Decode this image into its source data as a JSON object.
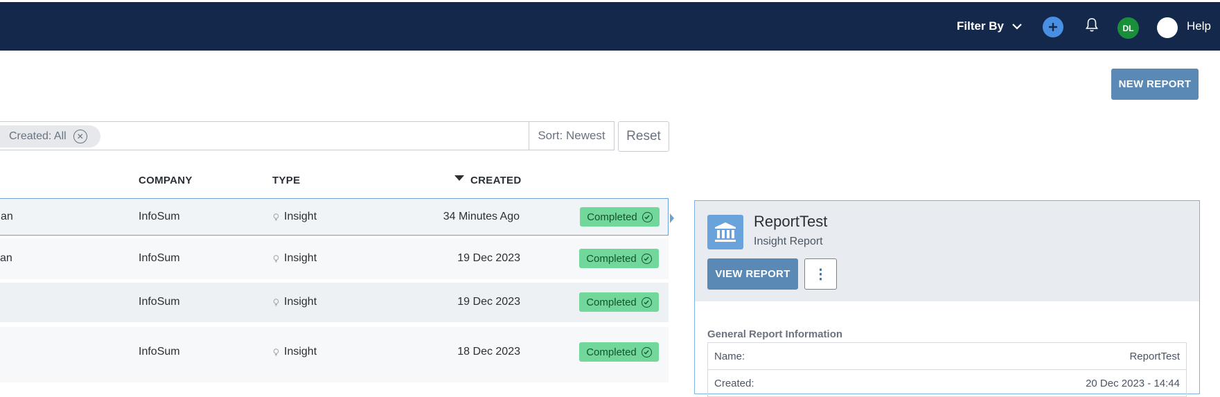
{
  "header": {
    "filter_by": "Filter By",
    "avatar_initials": "DL",
    "help_label": "Help",
    "help_glyph": "?"
  },
  "actions": {
    "new_report": "NEW REPORT"
  },
  "filters": {
    "chip_label": "Created: All",
    "sort_label": "Sort: Newest",
    "reset_label": "Reset"
  },
  "table": {
    "columns": {
      "company": "COMPANY",
      "type": "TYPE",
      "created": "CREATED"
    },
    "rows": [
      {
        "name": "an",
        "company": "InfoSum",
        "type": "Insight",
        "created": "34 Minutes Ago",
        "status": "Completed"
      },
      {
        "name": "an",
        "company": "InfoSum",
        "type": "Insight",
        "created": "19 Dec 2023",
        "status": "Completed"
      },
      {
        "name": "",
        "company": "InfoSum",
        "type": "Insight",
        "created": "19 Dec 2023",
        "status": "Completed"
      },
      {
        "name": "",
        "company": "InfoSum",
        "type": "Insight",
        "created": "18 Dec 2023",
        "status": "Completed"
      }
    ]
  },
  "detail": {
    "title": "ReportTest",
    "subtitle": "Insight Report",
    "view_report": "VIEW REPORT",
    "more_glyph": "⋮",
    "section_title": "General Report Information",
    "fields": [
      {
        "label": "Name:",
        "value": "ReportTest"
      },
      {
        "label": "Created:",
        "value": "20 Dec 2023 - 14:44"
      }
    ]
  },
  "colors": {
    "topbar": "#13284b",
    "primary_button": "#5b89b6",
    "status_completed": "#72d79b",
    "avatar": "#1a8f3a",
    "add_button": "#4a90e2"
  },
  "icons": [
    "chevron-down-icon",
    "plus-icon",
    "bell-icon",
    "help-icon",
    "close-circle-icon",
    "sort-desc-icon",
    "lightbulb-icon",
    "check-circle-icon",
    "bank-icon",
    "kebab-icon"
  ]
}
